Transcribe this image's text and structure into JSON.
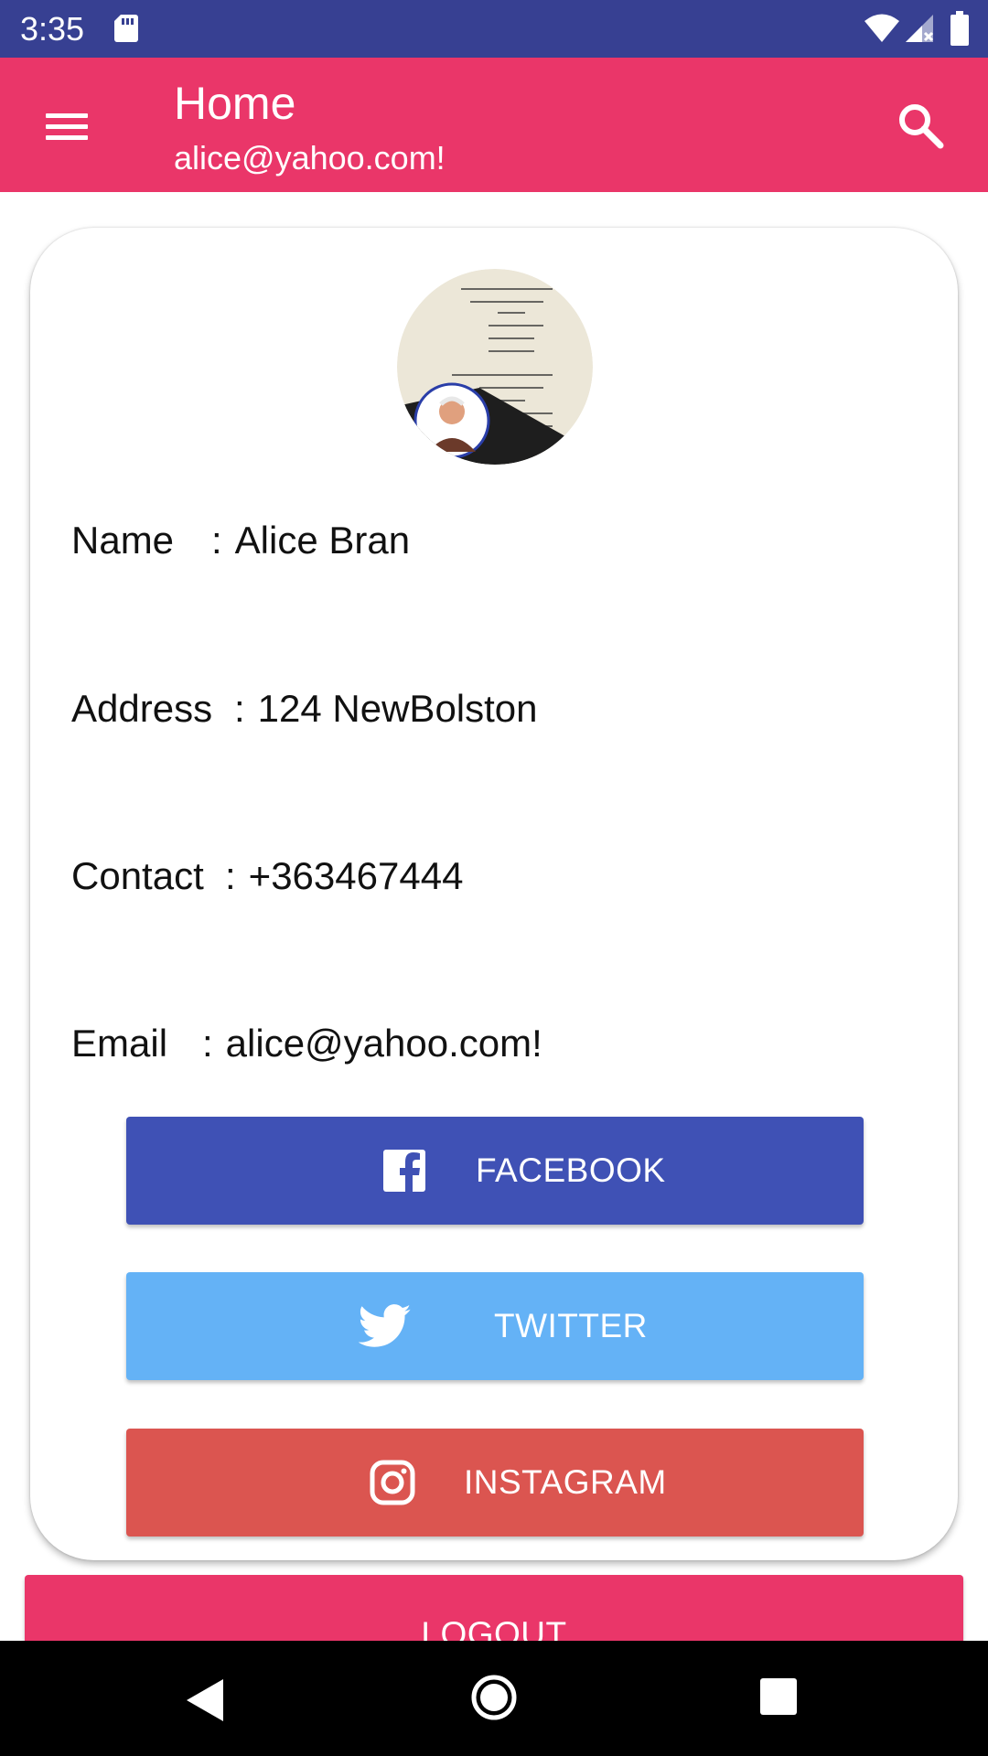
{
  "status_bar": {
    "time": "3:35",
    "background": "#374092",
    "icons": [
      "sd-card-icon",
      "wifi-icon",
      "signal-icon",
      "battery-icon"
    ]
  },
  "app_bar": {
    "title": "Home",
    "subtitle": "alice@yahoo.com!",
    "background": "#ea3669",
    "icons": [
      "menu-icon",
      "search-icon"
    ]
  },
  "profile": {
    "avatar": "profile-avatar",
    "name_label": "Name",
    "name_sep": ":",
    "name_value": "Alice Bran",
    "address_label": "Address",
    "address_sep": ":",
    "address_value": "124 NewBolston",
    "contact_label": "Contact",
    "contact_sep": ":",
    "contact_value": "+363467444",
    "email_label": "Email",
    "email_sep": ":",
    "email_value": "alice@yahoo.com!"
  },
  "social": {
    "facebook_label": "FACEBOOK",
    "facebook_color": "#3f51b5",
    "twitter_label": "TWITTER",
    "twitter_color": "#64b2f6",
    "instagram_label": "INSTAGRAM",
    "instagram_color": "#db5550"
  },
  "logout": {
    "label": "LOGOUT",
    "color": "#ea3669"
  },
  "nav_bar": {
    "icons": [
      "back-icon",
      "home-icon",
      "recent-apps-icon"
    ]
  }
}
